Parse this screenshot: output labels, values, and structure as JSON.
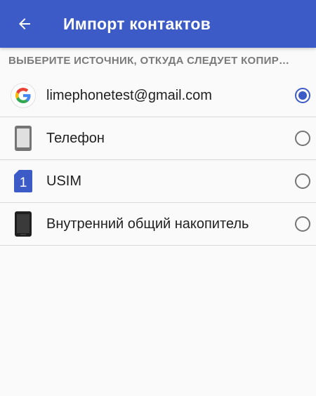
{
  "appbar": {
    "title": "Импорт контактов",
    "back_icon": "arrow-back-icon",
    "color": "#3d5bc7"
  },
  "section_header": "ВЫБЕРИТЕ ИСТОЧНИК, ОТКУДА СЛЕДУЕТ КОПИР…",
  "sources": [
    {
      "label": "limephonetest@gmail.com",
      "icon": "google-icon",
      "selected": true
    },
    {
      "label": "Телефон",
      "icon": "phone-icon",
      "selected": false
    },
    {
      "label": "USIM",
      "icon": "sim-card-icon",
      "icon_text": "1",
      "selected": false
    },
    {
      "label": "Внутренний общий накопитель",
      "icon": "internal-storage-icon",
      "selected": false
    }
  ]
}
